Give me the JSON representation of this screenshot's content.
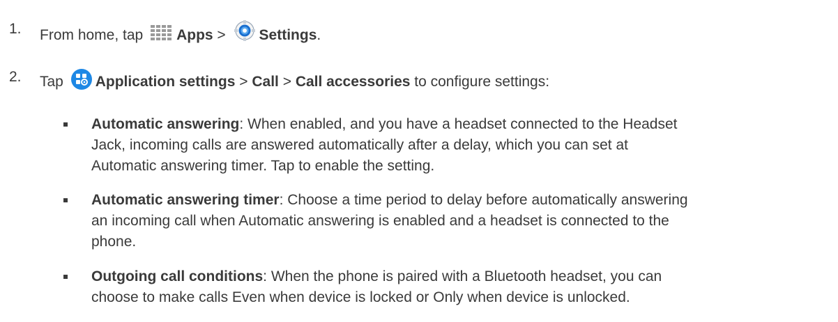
{
  "steps": [
    {
      "number": "1.",
      "lead": "From home, tap",
      "apps_label": "Apps",
      "sep": ">",
      "settings_label": "Settings",
      "end": "."
    },
    {
      "number": "2.",
      "lead": "Tap",
      "app_settings_label": "Application settings",
      "sep1": ">",
      "call_label": "Call",
      "sep2": ">",
      "accessories_label": "Call accessories",
      "tail": "to configure settings:"
    }
  ],
  "bullets": [
    {
      "term": "Automatic answering",
      "lines": [
        ": When enabled, and you have a headset connected to the Headset",
        "Jack, incoming calls are answered automatically after a delay, which you can set at",
        "Automatic answering timer. Tap to enable the setting."
      ]
    },
    {
      "term": "Automatic answering timer",
      "lines": [
        ": Choose a time period to delay before automatically answering",
        "an incoming call when Automatic answering is enabled and a headset is connected to the",
        "phone."
      ]
    },
    {
      "term": "Outgoing call conditions",
      "lines": [
        ": When the phone is paired with a Bluetooth headset, you can",
        "choose to make calls Even when device is locked or Only when device is unlocked."
      ]
    }
  ],
  "icons": {
    "apps": "apps-grid-icon",
    "settings": "settings-gear-icon",
    "application_settings": "application-settings-icon"
  },
  "colors": {
    "text": "#3a3a3a",
    "apps_icon": "#9a9a9a",
    "settings_blue": "#1a6fcf",
    "app_settings_blue": "#1e88e5"
  }
}
